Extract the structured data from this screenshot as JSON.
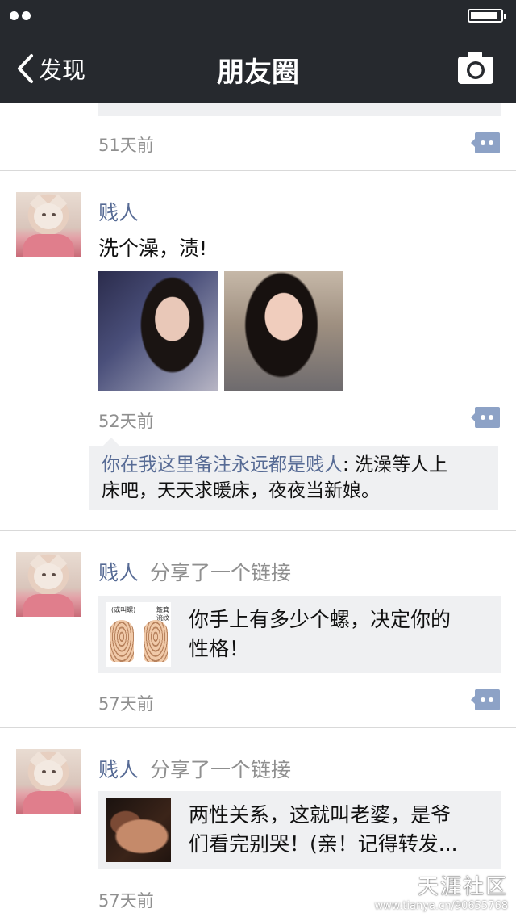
{
  "status_bar": {
    "signal_dots": 2,
    "battery_level": 0.85
  },
  "nav": {
    "back_label": "发现",
    "title": "朋友圈"
  },
  "posts": [
    {
      "time": "51天前"
    },
    {
      "name": "贱人",
      "text": "洗个澡，渍!",
      "time": "52天前",
      "comment": {
        "user": "你在我这里备注永远都是贱人",
        "line1": ": 洗澡等人上",
        "line2": "床吧，天天求暖床，夜夜当新娘。"
      }
    },
    {
      "name": "贱人",
      "action": "分享了一个链接",
      "link_thumb_labels": [
        "(或叫螺)",
        "簸箕",
        "流纹"
      ],
      "link_line1": "你手上有多少个螺，决定你的",
      "link_line2": "性格！",
      "time": "57天前"
    },
    {
      "name": "贱人",
      "action": "分享了一个链接",
      "link_line1": "两性关系，这就叫老婆，是爷",
      "link_line2": "们看完别哭！(亲！记得转发...",
      "time": "57天前"
    }
  ],
  "watermark": {
    "brand": "天涯社区",
    "url": "www.tianya.cn/90655768"
  },
  "colors": {
    "nav_bg": "#26292e",
    "name_link": "#576b95",
    "time_gray": "#8f8f8f",
    "comment_bg": "#eff0f2",
    "comment_btn": "#8da2c6"
  }
}
